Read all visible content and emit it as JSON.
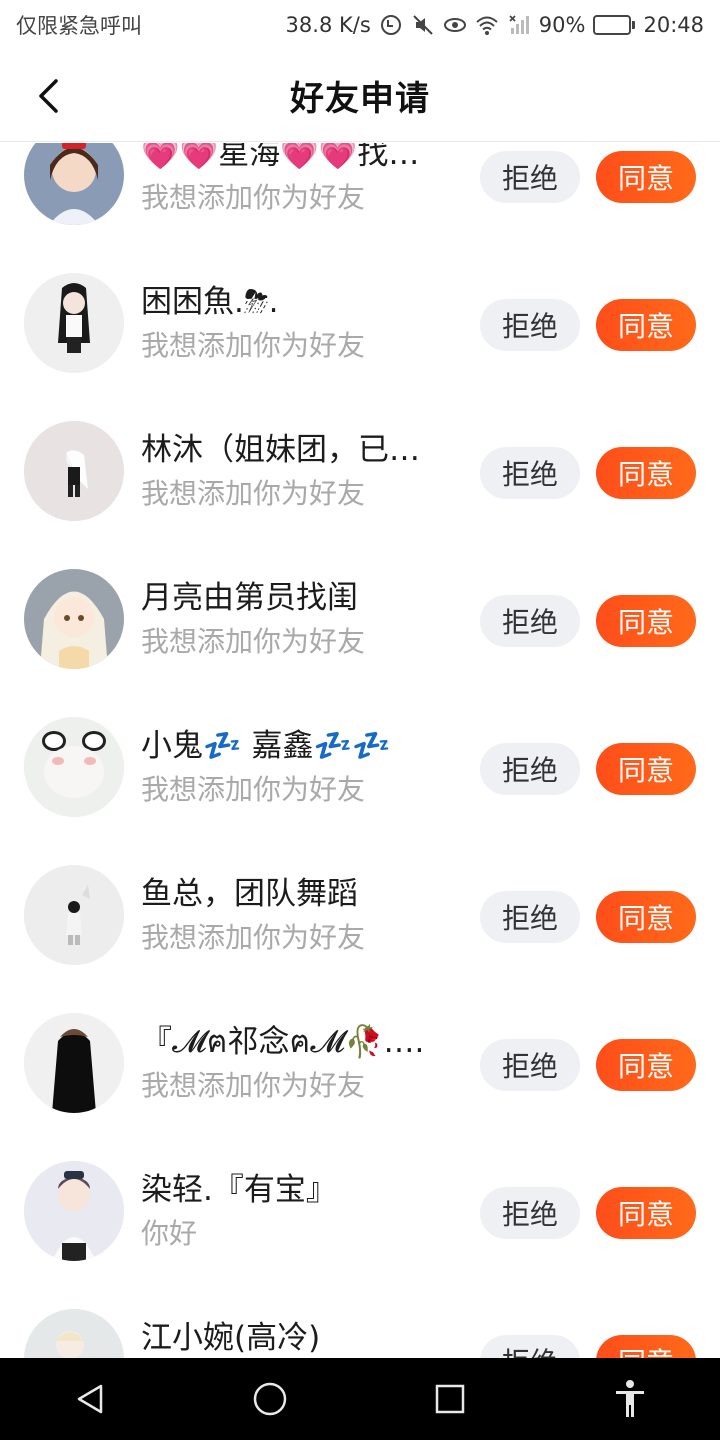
{
  "status_bar": {
    "left_text": "仅限紧急呼叫",
    "speed": "38.8 K/s",
    "battery": "90%",
    "battery_level": 0.9,
    "time": "20:48"
  },
  "header": {
    "title": "好友申请",
    "back_icon": "chevron-left-icon"
  },
  "requests": [
    {
      "name": "💗💗星海💗💗找…",
      "message": "我想添加你为好友",
      "reject_label": "拒绝",
      "accept_label": "同意"
    },
    {
      "name": "困困魚.⛈.",
      "message": "我想添加你为好友",
      "reject_label": "拒绝",
      "accept_label": "同意"
    },
    {
      "name": "林沐（姐妹团，已…",
      "message": "我想添加你为好友",
      "reject_label": "拒绝",
      "accept_label": "同意"
    },
    {
      "name": "月亮由第员找闺",
      "message": "我想添加你为好友",
      "reject_label": "拒绝",
      "accept_label": "同意"
    },
    {
      "name": "小鬼💤 嘉鑫💤💤",
      "message": "我想添加你为好友",
      "reject_label": "拒绝",
      "accept_label": "同意"
    },
    {
      "name": "鱼总，团队舞蹈",
      "message": "我想添加你为好友",
      "reject_label": "拒绝",
      "accept_label": "同意"
    },
    {
      "name": "『𝓜ฅ祁念ฅ𝓜🥀….",
      "message": "我想添加你为好友",
      "reject_label": "拒绝",
      "accept_label": "同意"
    },
    {
      "name": "染轻.『有宝』",
      "message": "你好",
      "reject_label": "拒绝",
      "accept_label": "同意"
    },
    {
      "name": "江小婉(高冷)",
      "message": "",
      "reject_label": "拒绝",
      "accept_label": "同意"
    }
  ],
  "nav_bar": {
    "back": "triangle-back-icon",
    "home": "circle-home-icon",
    "recents": "square-recents-icon",
    "accessibility": "accessibility-person-icon"
  },
  "colors": {
    "accept": "#ff5a1a",
    "reject_bg": "#eef0f4",
    "message_gray": "#a9a9a9",
    "nav_bg": "#000000"
  }
}
